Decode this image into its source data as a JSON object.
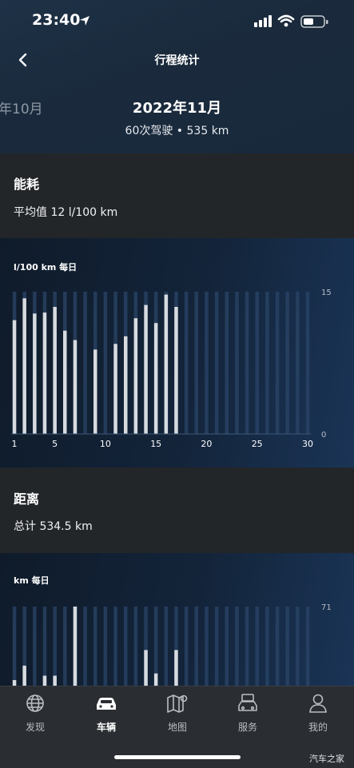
{
  "status_bar": {
    "time": "23:40"
  },
  "header": {
    "title": "行程统计",
    "back_icon": "chevron-left-icon"
  },
  "month_selector": {
    "previous_month": "年10月",
    "current_month": "2022年11月",
    "summary": "60次驾驶 • 535 km"
  },
  "energy": {
    "title": "能耗",
    "average": "平均值 12 l/100 km",
    "chart_data": {
      "type": "bar",
      "title": "l/100 km 每日",
      "x": [
        1,
        2,
        3,
        4,
        5,
        6,
        7,
        8,
        9,
        10,
        11,
        12,
        13,
        14,
        15,
        16,
        17,
        18,
        19,
        20,
        21,
        22,
        23,
        24,
        25,
        26,
        27,
        28,
        29,
        30
      ],
      "values": [
        12.0,
        14.3,
        12.7,
        12.8,
        13.4,
        10.9,
        9.9,
        null,
        8.9,
        null,
        9.5,
        10.3,
        12.2,
        13.6,
        11.7,
        14.7,
        13.4,
        null,
        null,
        null,
        null,
        null,
        null,
        null,
        null,
        null,
        null,
        null,
        null,
        null
      ],
      "x_ticks": [
        "1",
        "5",
        "10",
        "15",
        "20",
        "25",
        "30"
      ],
      "ylim": [
        0,
        15
      ],
      "y_ticks": [
        "15",
        "0"
      ],
      "bar_color": "#d7dbe0",
      "track_color": "#2b4668"
    }
  },
  "distance": {
    "title": "距离",
    "total": "总计 534.5 km",
    "chart_data": {
      "type": "bar",
      "title": "km 每日",
      "x": [
        1,
        2,
        3,
        4,
        5,
        6,
        7,
        8,
        9,
        10,
        11,
        12,
        13,
        14,
        15,
        16,
        17,
        18,
        19,
        20,
        21,
        22,
        23,
        24,
        25,
        26,
        27,
        28,
        29,
        30
      ],
      "values": [
        5,
        18,
        null,
        9,
        9,
        null,
        71,
        null,
        null,
        null,
        null,
        null,
        null,
        32,
        11,
        null,
        32,
        null,
        null,
        null,
        null,
        null,
        null,
        null,
        null,
        null,
        null,
        null,
        null,
        null
      ],
      "ylim": [
        0,
        71
      ],
      "y_ticks": [
        "71"
      ],
      "bar_color": "#d7dbe0",
      "track_color": "#2b4668"
    }
  },
  "tabbar": {
    "items": [
      {
        "label": "发现",
        "icon": "globe-icon"
      },
      {
        "label": "车辆",
        "icon": "car-icon",
        "active": true
      },
      {
        "label": "地图",
        "icon": "map-icon"
      },
      {
        "label": "服务",
        "icon": "car-service-icon"
      },
      {
        "label": "我的",
        "icon": "person-icon"
      }
    ]
  },
  "watermark": "汽车之家"
}
